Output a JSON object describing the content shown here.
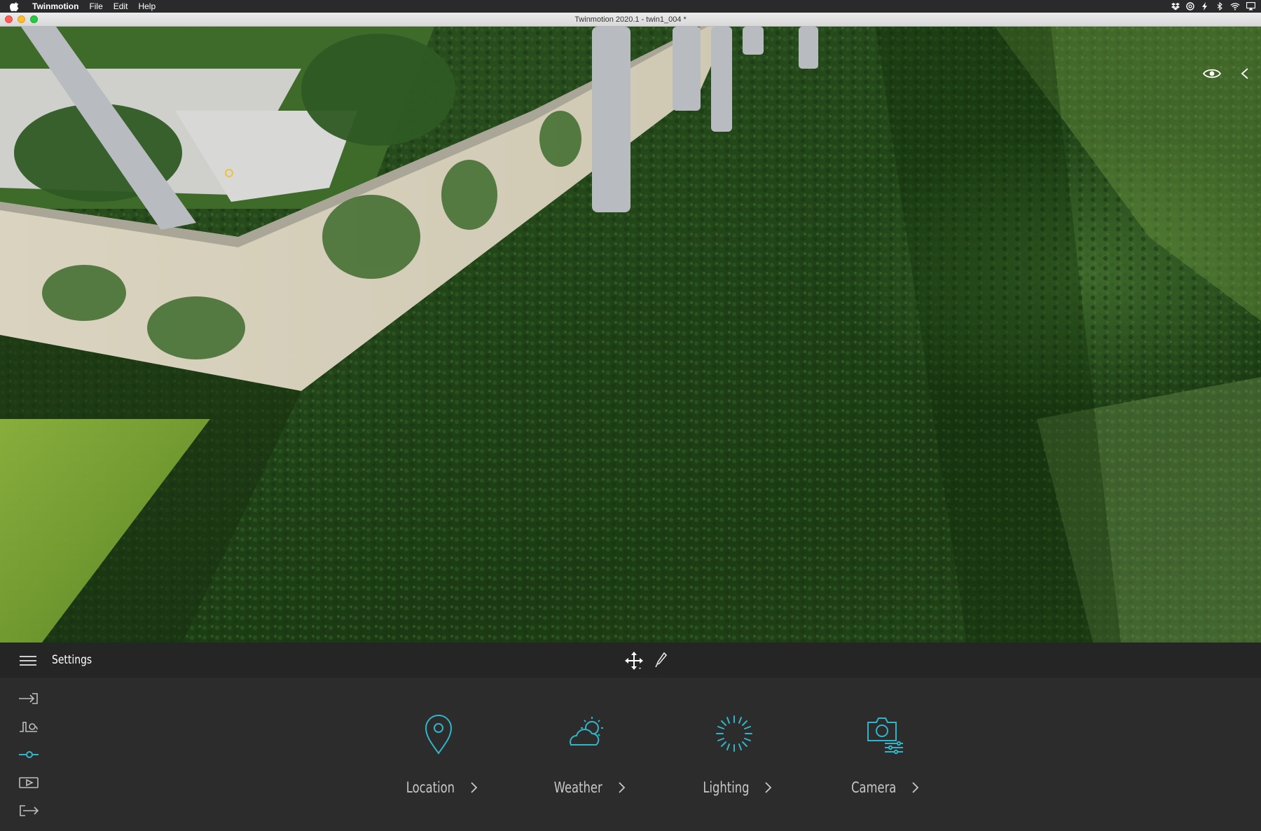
{
  "menubar": {
    "app_name": "Twinmotion",
    "menus": [
      "File",
      "Edit",
      "Help"
    ],
    "status_icons": [
      "dropbox-icon",
      "creative-cloud-icon",
      "bolt-icon",
      "bluetooth-icon",
      "wifi-icon",
      "airplay-icon"
    ]
  },
  "window": {
    "title": "Twinmotion 2020.1 - twin1_004 *"
  },
  "viewport": {
    "icons": [
      "eye-icon",
      "collapse-panel-icon"
    ]
  },
  "toolbar": {
    "title": "Settings",
    "tools": [
      "move-icon",
      "eyedropper-icon"
    ]
  },
  "side_nav": {
    "items": [
      "import-icon",
      "context-icon",
      "settings-sliders-icon",
      "media-icon",
      "export-icon"
    ],
    "active_index": 2
  },
  "settings_cards": [
    {
      "label": "Location",
      "icon": "location-pin-icon"
    },
    {
      "label": "Weather",
      "icon": "weather-icon"
    },
    {
      "label": "Lighting",
      "icon": "lighting-icon"
    },
    {
      "label": "Camera",
      "icon": "camera-icon"
    }
  ],
  "colors": {
    "accent": "#33b5c9",
    "panel_bg": "#2c2c2c",
    "toolbar_bg": "#252525",
    "label": "#c8c8c8"
  }
}
